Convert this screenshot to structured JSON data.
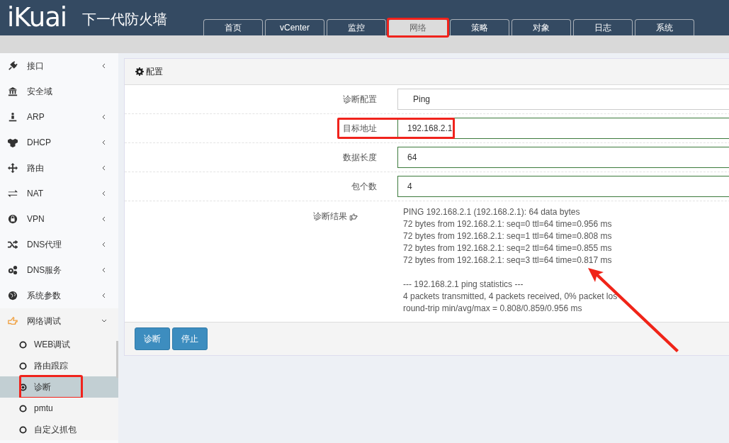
{
  "header": {
    "logo": "iKuai",
    "subtitle": "下一代防火墙"
  },
  "tabs": [
    {
      "label": "首页",
      "selected": false,
      "highlighted": false
    },
    {
      "label": "vCenter",
      "selected": false,
      "highlighted": false
    },
    {
      "label": "监控",
      "selected": false,
      "highlighted": false
    },
    {
      "label": "网络",
      "selected": true,
      "highlighted": true
    },
    {
      "label": "策略",
      "selected": false,
      "highlighted": false
    },
    {
      "label": "对象",
      "selected": false,
      "highlighted": false
    },
    {
      "label": "日志",
      "selected": false,
      "highlighted": false
    },
    {
      "label": "系统",
      "selected": false,
      "highlighted": false
    }
  ],
  "sidebar": {
    "items": [
      {
        "label": "接口",
        "kind": "group",
        "expanded": false
      },
      {
        "label": "安全域",
        "kind": "link"
      },
      {
        "label": "ARP",
        "kind": "group",
        "expanded": false
      },
      {
        "label": "DHCP",
        "kind": "group",
        "expanded": false
      },
      {
        "label": "路由",
        "kind": "group",
        "expanded": false
      },
      {
        "label": "NAT",
        "kind": "group",
        "expanded": false
      },
      {
        "label": "VPN",
        "kind": "group",
        "expanded": false
      },
      {
        "label": "DNS代理",
        "kind": "group",
        "expanded": false
      },
      {
        "label": "DNS服务",
        "kind": "group",
        "expanded": false
      },
      {
        "label": "系统参数",
        "kind": "group",
        "expanded": false
      },
      {
        "label": "网络调试",
        "kind": "group",
        "expanded": true,
        "children": [
          {
            "label": "WEB调试",
            "selected": false,
            "highlighted": false
          },
          {
            "label": "路由跟踪",
            "selected": false,
            "highlighted": false
          },
          {
            "label": "诊断",
            "selected": true,
            "highlighted": true
          },
          {
            "label": "pmtu",
            "selected": false,
            "highlighted": false
          },
          {
            "label": "自定义抓包",
            "selected": false,
            "highlighted": false
          }
        ]
      }
    ]
  },
  "panel": {
    "title": "配置",
    "fields": [
      {
        "label": "诊断配置",
        "kind": "select",
        "value": "Ping",
        "highlighted": false
      },
      {
        "label": "目标地址",
        "kind": "input",
        "value": "192.168.2.1",
        "highlighted": true
      },
      {
        "label": "数据长度",
        "kind": "input",
        "value": "64",
        "highlighted": false
      },
      {
        "label": "包个数",
        "kind": "input",
        "value": "4",
        "highlighted": false
      }
    ],
    "result": {
      "label": "诊断结果",
      "lines": [
        "PING 192.168.2.1 (192.168.2.1): 64 data bytes",
        "72 bytes from 192.168.2.1: seq=0 ttl=64 time=0.956 ms",
        "72 bytes from 192.168.2.1: seq=1 ttl=64 time=0.808 ms",
        "72 bytes from 192.168.2.1: seq=2 ttl=64 time=0.855 ms",
        "72 bytes from 192.168.2.1: seq=3 ttl=64 time=0.817 ms"
      ],
      "stats": [
        "--- 192.168.2.1 ping statistics ---",
        "4 packets transmitted, 4 packets received, 0% packet los",
        "round-trip min/avg/max = 0.808/0.859/0.956 ms"
      ]
    },
    "buttons": [
      "诊断",
      "停止"
    ]
  }
}
